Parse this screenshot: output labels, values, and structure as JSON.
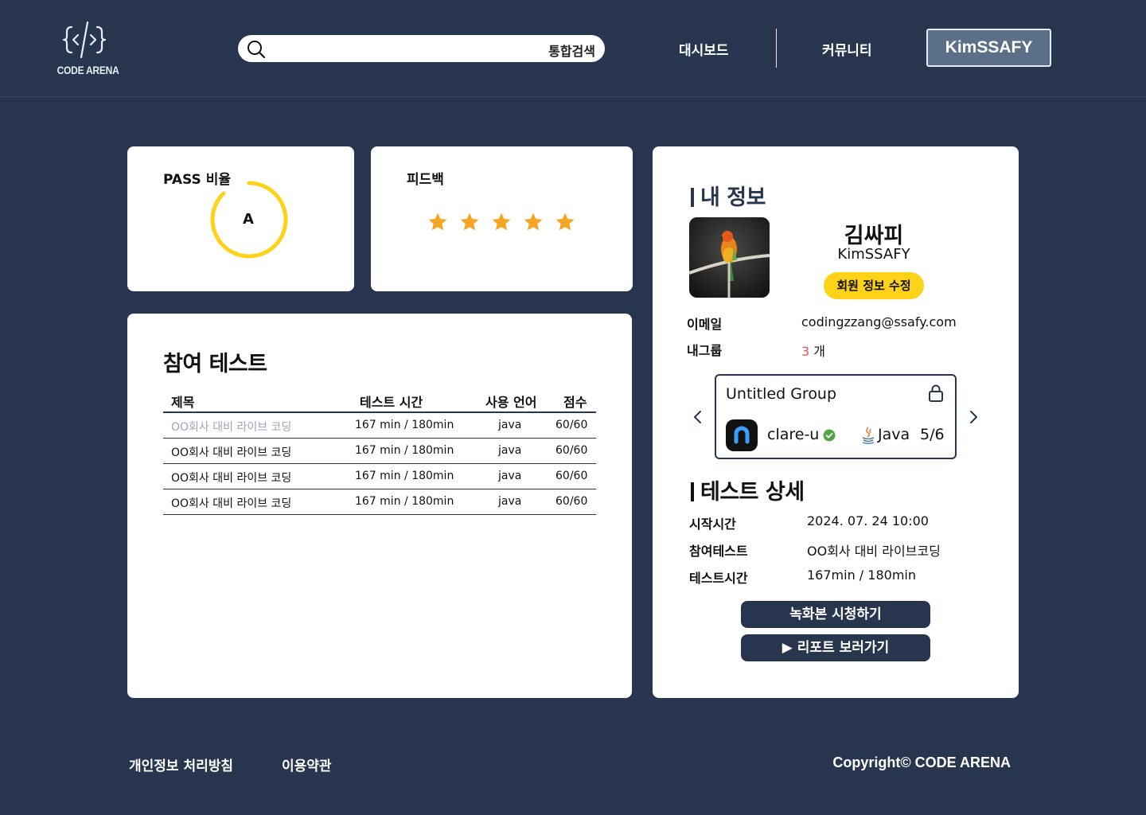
{
  "header": {
    "logo_text": "CODE ARENA",
    "search_label": "통합검색",
    "nav": {
      "dashboard": "대시보드",
      "community": "커뮤니티"
    },
    "user_button": "KimSSAFY"
  },
  "pass_card": {
    "title": "PASS 비율",
    "grade": "A",
    "ring_color": "#ffd21a"
  },
  "feedback_card": {
    "title": "피드백",
    "rating": 5,
    "max_rating": 5,
    "star_color": "#f6a623"
  },
  "tests_card": {
    "title": "참여 테스트",
    "columns": {
      "title": "제목",
      "time": "테스트 시간",
      "lang": "사용 언어",
      "score": "점수"
    },
    "rows": [
      {
        "title": "OO회사 대비 라이브 코딩",
        "time": "167 min / 180min",
        "lang": "java",
        "score": "60/60"
      },
      {
        "title": "OO회사 대비 라이브 코딩",
        "time": "167 min / 180min",
        "lang": "java",
        "score": "60/60"
      },
      {
        "title": "OO회사 대비 라이브 코딩",
        "time": "167 min / 180min",
        "lang": "java",
        "score": "60/60"
      },
      {
        "title": "OO회사 대비 라이브 코딩",
        "time": "167 min / 180min",
        "lang": "java",
        "score": "60/60"
      }
    ]
  },
  "info_card": {
    "title": "내 정보",
    "name_ko": "김싸피",
    "name_en": "KimSSAFY",
    "edit_button": "회원 정보 수정",
    "email_label": "이메일",
    "email_value": "codingzzang@ssafy.com",
    "group_label": "내그룹",
    "group_count": "3",
    "group_unit": " 개",
    "group": {
      "name": "Untitled Group",
      "member_name": "clare-u",
      "language": "Java",
      "member_count": "5/6"
    },
    "detail": {
      "title": "테스트 상세",
      "start_label": "시작시간",
      "start_value": "2024. 07. 24 10:00",
      "test_label": "참여테스트",
      "test_value": "OO회사 대비 라이브코딩",
      "time_label": "테스트시간",
      "time_value": "167min  / 180min"
    },
    "record_button": "녹화본 시청하기",
    "report_button": "▶ 리포트 보러가기"
  },
  "footer": {
    "privacy": "개인정보 처리방침",
    "terms": "이용약관",
    "copyright": "Copyright© CODE ARENA"
  },
  "colors": {
    "background": "#27364e",
    "accent": "#ffd21a",
    "highlight": "#e25757"
  }
}
